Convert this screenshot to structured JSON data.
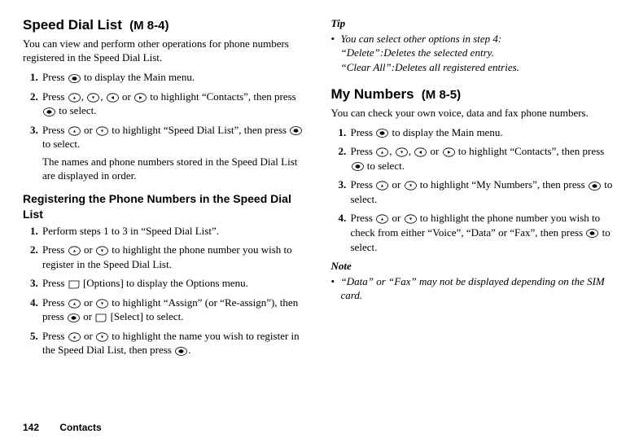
{
  "left": {
    "title": "Speed Dial List",
    "menuCode": "(M 8-4)",
    "intro": "You can view and perform other operations for phone numbers registered in the Speed Dial List.",
    "steps": [
      {
        "pre": "Press ",
        "icons": [
          "center"
        ],
        "post": " to display the Main menu."
      },
      {
        "pre": "Press ",
        "icons": [
          "up",
          "comma",
          "down",
          "comma",
          "left",
          "or",
          "right"
        ],
        "post": " to highlight “Contacts”, then press ",
        "icons2": [
          "center"
        ],
        "post2": " to select."
      },
      {
        "pre": "Press ",
        "icons": [
          "up",
          "or",
          "down"
        ],
        "post": " to highlight “Speed Dial List”, then press ",
        "icons2": [
          "center"
        ],
        "post2": " to select.",
        "extra": "The names and phone numbers stored in the Speed Dial List are displayed in order."
      }
    ],
    "sub": {
      "title": "Registering the Phone Numbers in the Speed Dial List",
      "steps": [
        {
          "pre": "Perform steps 1 to 3 in “Speed Dial List”.",
          "icons": []
        },
        {
          "pre": "Press ",
          "icons": [
            "up",
            "or",
            "down"
          ],
          "post": " to highlight the phone number you wish to register in the Speed Dial List."
        },
        {
          "pre": "Press ",
          "icons": [
            "soft"
          ],
          "post": " [Options] to display the Options menu."
        },
        {
          "pre": "Press ",
          "icons": [
            "up",
            "or",
            "down"
          ],
          "post": " to highlight “Assign” (or “Re-assign”), then press ",
          "icons2": [
            "center",
            "or",
            "soft"
          ],
          "post2": " [Select] to select."
        },
        {
          "pre": "Press ",
          "icons": [
            "up",
            "or",
            "down"
          ],
          "post": " to highlight the name you wish to register in the Speed Dial List, then press ",
          "icons2": [
            "center"
          ],
          "post2": "."
        }
      ]
    }
  },
  "right": {
    "tipHead": "Tip",
    "tipLines": [
      "You can select other options in step 4:",
      "“Delete”:Deletes the selected entry.",
      "“Clear All”:Deletes all registered entries."
    ],
    "title": "My Numbers",
    "menuCode": "(M 8-5)",
    "intro": "You can check your own voice, data and fax phone numbers.",
    "steps": [
      {
        "pre": "Press ",
        "icons": [
          "center"
        ],
        "post": " to display the Main menu."
      },
      {
        "pre": "Press ",
        "icons": [
          "up",
          "comma",
          "down",
          "comma",
          "left",
          "or",
          "right"
        ],
        "post": " to highlight “Contacts”, then press ",
        "icons2": [
          "center"
        ],
        "post2": " to select."
      },
      {
        "pre": "Press ",
        "icons": [
          "up",
          "or",
          "down"
        ],
        "post": " to highlight “My Numbers”, then press ",
        "icons2": [
          "center"
        ],
        "post2": " to select."
      },
      {
        "pre": "Press ",
        "icons": [
          "up",
          "or",
          "down"
        ],
        "post": " to highlight the phone number you wish to check from either “Voice”, “Data” or “Fax”, then press ",
        "icons2": [
          "center"
        ],
        "post2": " to select."
      }
    ],
    "noteHead": "Note",
    "noteBody": "“Data” or “Fax” may not be displayed depending on the SIM card."
  },
  "footer": {
    "pageNum": "142",
    "section": "Contacts"
  },
  "connectors": {
    "comma": ", ",
    "or": " or "
  }
}
